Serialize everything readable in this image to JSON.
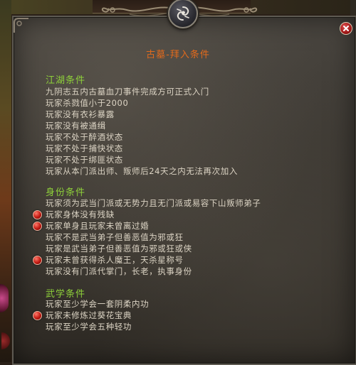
{
  "panel": {
    "title": "古墓-拜入条件",
    "emblem_icon": "swirl-emblem-icon",
    "close_icon": "close-icon"
  },
  "colors": {
    "title": "#e26a1c",
    "heading": "#8ed03a",
    "text": "#dcd4c4",
    "bullet": "#c21a12"
  },
  "sections": [
    {
      "heading": "江湖条件",
      "items": [
        {
          "text": "九阴志五内古墓血刀事件完成方可正式入门",
          "marked": false
        },
        {
          "text": "玩家杀戮值小于2000",
          "marked": false
        },
        {
          "text": "玩家没有衣衫暴露",
          "marked": false
        },
        {
          "text": "玩家没有被通缉",
          "marked": false
        },
        {
          "text": "玩家不处于醉酒状态",
          "marked": false
        },
        {
          "text": "玩家不处于捕快状态",
          "marked": false
        },
        {
          "text": "玩家不处于绑匪状态",
          "marked": false
        },
        {
          "text": "玩家从本门派出师、叛师后24天之内无法再次加入",
          "marked": false
        }
      ]
    },
    {
      "heading": "身份条件",
      "items": [
        {
          "text": "玩家须为武当门派或无势力且无门派或易容下山叛师弟子",
          "marked": false
        },
        {
          "text": "玩家身体没有残缺",
          "marked": true
        },
        {
          "text": "玩家单身且玩家未曾离过婚",
          "marked": true
        },
        {
          "text": "玩家不是武当弟子但善恶值为邪或狂",
          "marked": false
        },
        {
          "text": "玩家是武当弟子但善恶值为邪或狂或侠",
          "marked": false
        },
        {
          "text": "玩家未曾获得杀人魔王，天杀星称号",
          "marked": true
        },
        {
          "text": "玩家没有门派代掌门，长老，执事身份",
          "marked": false
        }
      ]
    },
    {
      "heading": "武学条件",
      "items": [
        {
          "text": "玩家至少学会一套阴柔内功",
          "marked": false
        },
        {
          "text": "玩家未修炼过葵花宝典",
          "marked": true
        },
        {
          "text": "玩家至少学会五种轻功",
          "marked": false
        }
      ]
    }
  ]
}
